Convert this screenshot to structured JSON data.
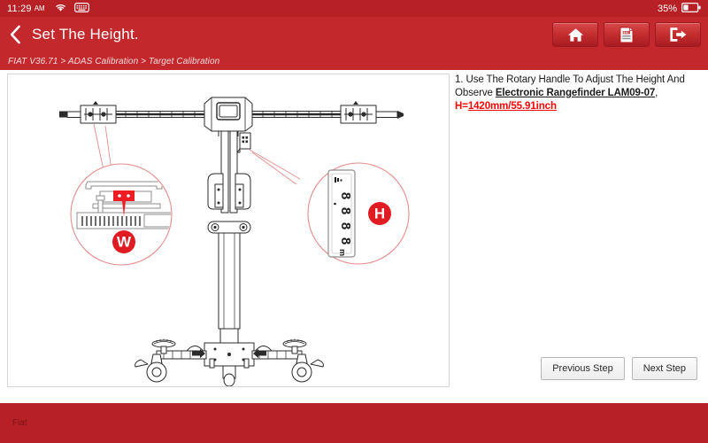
{
  "statusbar": {
    "time": "11:29",
    "ampm": "AM",
    "wifi_icon": "wifi-icon",
    "keyboard_icon": "keyboard-icon",
    "battery_percent": "35%",
    "battery_icon": "battery-icon"
  },
  "titlebar": {
    "back_icon": "chevron-left-icon",
    "title": "Set The Height.",
    "buttons": [
      {
        "name": "home-button",
        "icon": "home-icon"
      },
      {
        "name": "report-button",
        "icon": "report-icon"
      },
      {
        "name": "exit-button",
        "icon": "exit-icon"
      }
    ]
  },
  "breadcrumb": {
    "text": "FIAT V36.71 > ADAS Calibration > Target Calibration"
  },
  "instructions": {
    "step_prefix": "1. Use The Rotary Handle To Adjust The Height And Observe ",
    "device_name": "Electronic Rangefinder LAM09-07",
    "comma": ",",
    "height_label": "H=",
    "height_value": "1420mm/55.91inch"
  },
  "diagram": {
    "callout_w_label": "W",
    "callout_h_label": "H",
    "rangefinder_digits": "8.8.8.8",
    "rangefinder_unit": "m",
    "alt_text": "ADAS target calibration stand with crossbar, telescoping mast and wheeled base"
  },
  "buttons": {
    "previous_step": "Previous Step",
    "next_step": "Next Step"
  },
  "footer": {
    "brand": "Fiat"
  },
  "colors": {
    "status_red": "#b72025",
    "header_red": "#c3282d",
    "accent_red": "#ff0000",
    "panel_border": "#d7d7d7"
  }
}
